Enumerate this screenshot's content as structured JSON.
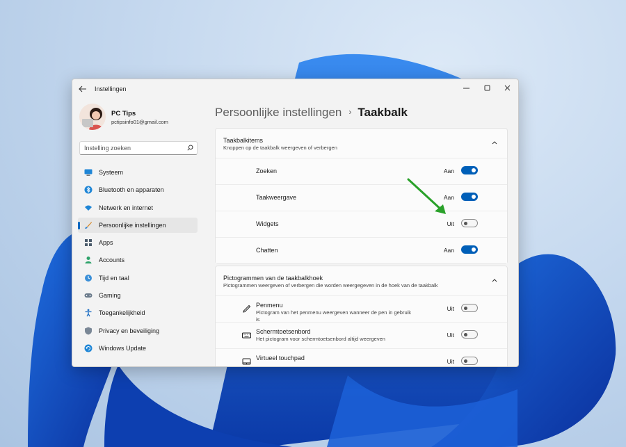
{
  "window": {
    "title": "Instellingen"
  },
  "profile": {
    "name": "PC Tips",
    "email": "pctipsinfo01@gmail.com"
  },
  "search": {
    "placeholder": "Instelling zoeken"
  },
  "sidebar": {
    "items": [
      {
        "label": "Systeem",
        "icon": "monitor-icon"
      },
      {
        "label": "Bluetooth en apparaten",
        "icon": "bluetooth-icon"
      },
      {
        "label": "Netwerk en internet",
        "icon": "wifi-icon"
      },
      {
        "label": "Persoonlijke instellingen",
        "icon": "brush-icon",
        "active": true
      },
      {
        "label": "Apps",
        "icon": "apps-icon"
      },
      {
        "label": "Accounts",
        "icon": "person-icon"
      },
      {
        "label": "Tijd en taal",
        "icon": "globe-clock-icon"
      },
      {
        "label": "Gaming",
        "icon": "gamepad-icon"
      },
      {
        "label": "Toegankelijkheid",
        "icon": "accessibility-icon"
      },
      {
        "label": "Privacy en beveiliging",
        "icon": "shield-icon"
      },
      {
        "label": "Windows Update",
        "icon": "update-icon"
      }
    ]
  },
  "breadcrumb": {
    "parent": "Persoonlijke instellingen",
    "separator": "›",
    "current": "Taakbalk"
  },
  "sections": {
    "taskbar_items": {
      "title": "Taakbalkitems",
      "subtitle": "Knoppen op de taakbalk weergeven of verbergen",
      "rows": [
        {
          "label": "Zoeken",
          "state": "Aan",
          "on": true
        },
        {
          "label": "Taakweergave",
          "state": "Aan",
          "on": true
        },
        {
          "label": "Widgets",
          "state": "Uit",
          "on": false
        },
        {
          "label": "Chatten",
          "state": "Aan",
          "on": true
        }
      ]
    },
    "corner_icons": {
      "title": "Pictogrammen van de taakbalkhoek",
      "subtitle": "Pictogrammen weergeven of verbergen die worden weergegeven in de hoek van de taakbalk",
      "rows": [
        {
          "title": "Penmenu",
          "description": "Pictogram van het penmenu weergeven wanneer de pen in gebruik is",
          "state": "Uit",
          "on": false,
          "icon": "pen-icon"
        },
        {
          "title": "Schermtoetsenbord",
          "description": "Het pictogram voor schermtoetsenbord altijd weergeven",
          "state": "Uit",
          "on": false,
          "icon": "keyboard-icon"
        },
        {
          "title": "Virtueel touchpad",
          "description": "",
          "state": "Uit",
          "on": false,
          "icon": "touchpad-icon"
        }
      ]
    }
  },
  "colors": {
    "accent": "#005fb8",
    "arrow": "#2aa12a",
    "window_bg": "#f3f3f3"
  }
}
